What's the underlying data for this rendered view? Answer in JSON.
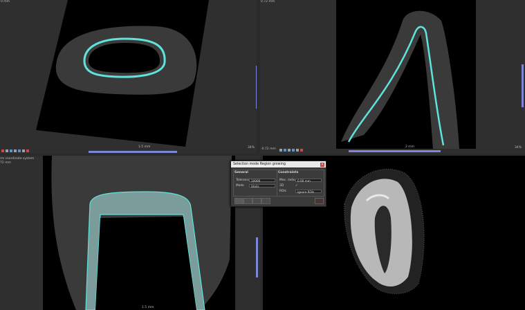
{
  "viewports": {
    "top_left": {
      "label": "0 mm",
      "scale": "1.5 mm"
    },
    "top_right": {
      "label": "0.72 mm",
      "scale": "2 mm",
      "coord": "-0.72 mm",
      "zoom": "34%"
    },
    "bottom_left": {
      "label_line1": "rm coordinate system",
      "label_line2": "72 mm",
      "scale": "1.5 mm"
    },
    "top_left_zoom": "34%"
  },
  "dialog": {
    "title": "Selection mode Region growing",
    "close_glyph": "×",
    "general": {
      "heading": "General",
      "tolerance_label": "Tolerance",
      "tolerance_value": "10000",
      "mode_label": "Mode",
      "mode_value": "Static"
    },
    "constraints": {
      "heading": "Constraints",
      "max_radius_label": "Max. radius",
      "max_radius_value": "0.00 mm",
      "threed_label": "3D",
      "threed_value": "✓",
      "rois_label": "ROIs",
      "rois_value": "Ignore ROIs"
    }
  },
  "colors": {
    "contour": "#5fe3dc",
    "scrollbar": "#7d86d8"
  }
}
